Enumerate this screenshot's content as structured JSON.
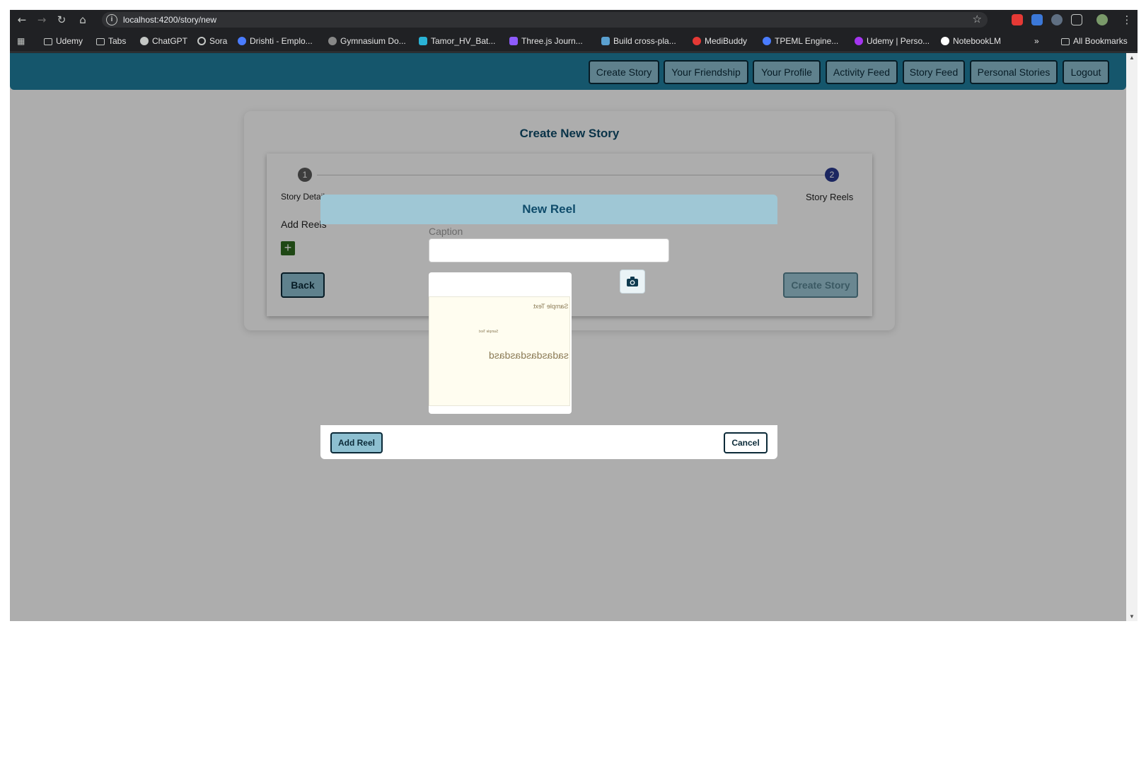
{
  "browser": {
    "url": "localhost:4200/story/new",
    "bookmarks": [
      {
        "label": "Udemy",
        "icon": "folder-icon",
        "color": "#c4c7c5"
      },
      {
        "label": "Tabs",
        "icon": "folder-icon",
        "color": "#c4c7c5"
      },
      {
        "label": "ChatGPT",
        "icon": "chatgpt-icon",
        "color": "#c4c7c5"
      },
      {
        "label": "Sora",
        "icon": "sora-icon",
        "color": "#c4c7c5"
      },
      {
        "label": "Drishti - Emplo...",
        "icon": "eye-icon",
        "color": "#4a7cff"
      },
      {
        "label": "Gymnasium Do...",
        "icon": "gym-icon",
        "color": "#888888"
      },
      {
        "label": "Tamor_HV_Bat...",
        "icon": "tamor-icon",
        "color": "#2ab3d6"
      },
      {
        "label": "Three.js Journ...",
        "icon": "threejs-icon",
        "color": "#8e5bff"
      },
      {
        "label": "Build cross-pla...",
        "icon": "build-icon",
        "color": "#5aa0d0"
      },
      {
        "label": "MediBuddy",
        "icon": "medibuddy-icon",
        "color": "#e53935"
      },
      {
        "label": "TPEML Engine...",
        "icon": "eye-icon",
        "color": "#4a7cff"
      },
      {
        "label": "Udemy | Perso...",
        "icon": "udemy-icon",
        "color": "#a435f0"
      },
      {
        "label": "NotebookLM",
        "icon": "notebooklm-icon",
        "color": "#ffffff"
      }
    ],
    "more": "»",
    "all_bookmarks": "All Bookmarks"
  },
  "nav": {
    "items": [
      "Create Story",
      "Your Friendship",
      "Your Profile",
      "Activity Feed",
      "Story Feed",
      "Personal Stories",
      "Logout"
    ]
  },
  "page": {
    "title": "Create New Story",
    "steps": [
      {
        "num": "1",
        "label": "Story Details",
        "color": "#5a5a5a"
      },
      {
        "num": "2",
        "label": "Story Reels",
        "color": "#2a3a8f"
      }
    ],
    "add_reels_label": "Add Reels",
    "add_icon": "+",
    "back_label": "Back",
    "create_label": "Create Story"
  },
  "modal": {
    "title": "New Reel",
    "caption_label": "Caption",
    "caption_value": "",
    "preview_texts": [
      "Sample Text",
      "Sample Text",
      "sadasdasdasdasd"
    ],
    "add_label": "Add Reel",
    "cancel_label": "Cancel"
  },
  "colors": {
    "header": "#1f7f9f",
    "button": "#8dbfd0",
    "title": "#0f4c6b",
    "add_button": "#2f6b1f"
  }
}
